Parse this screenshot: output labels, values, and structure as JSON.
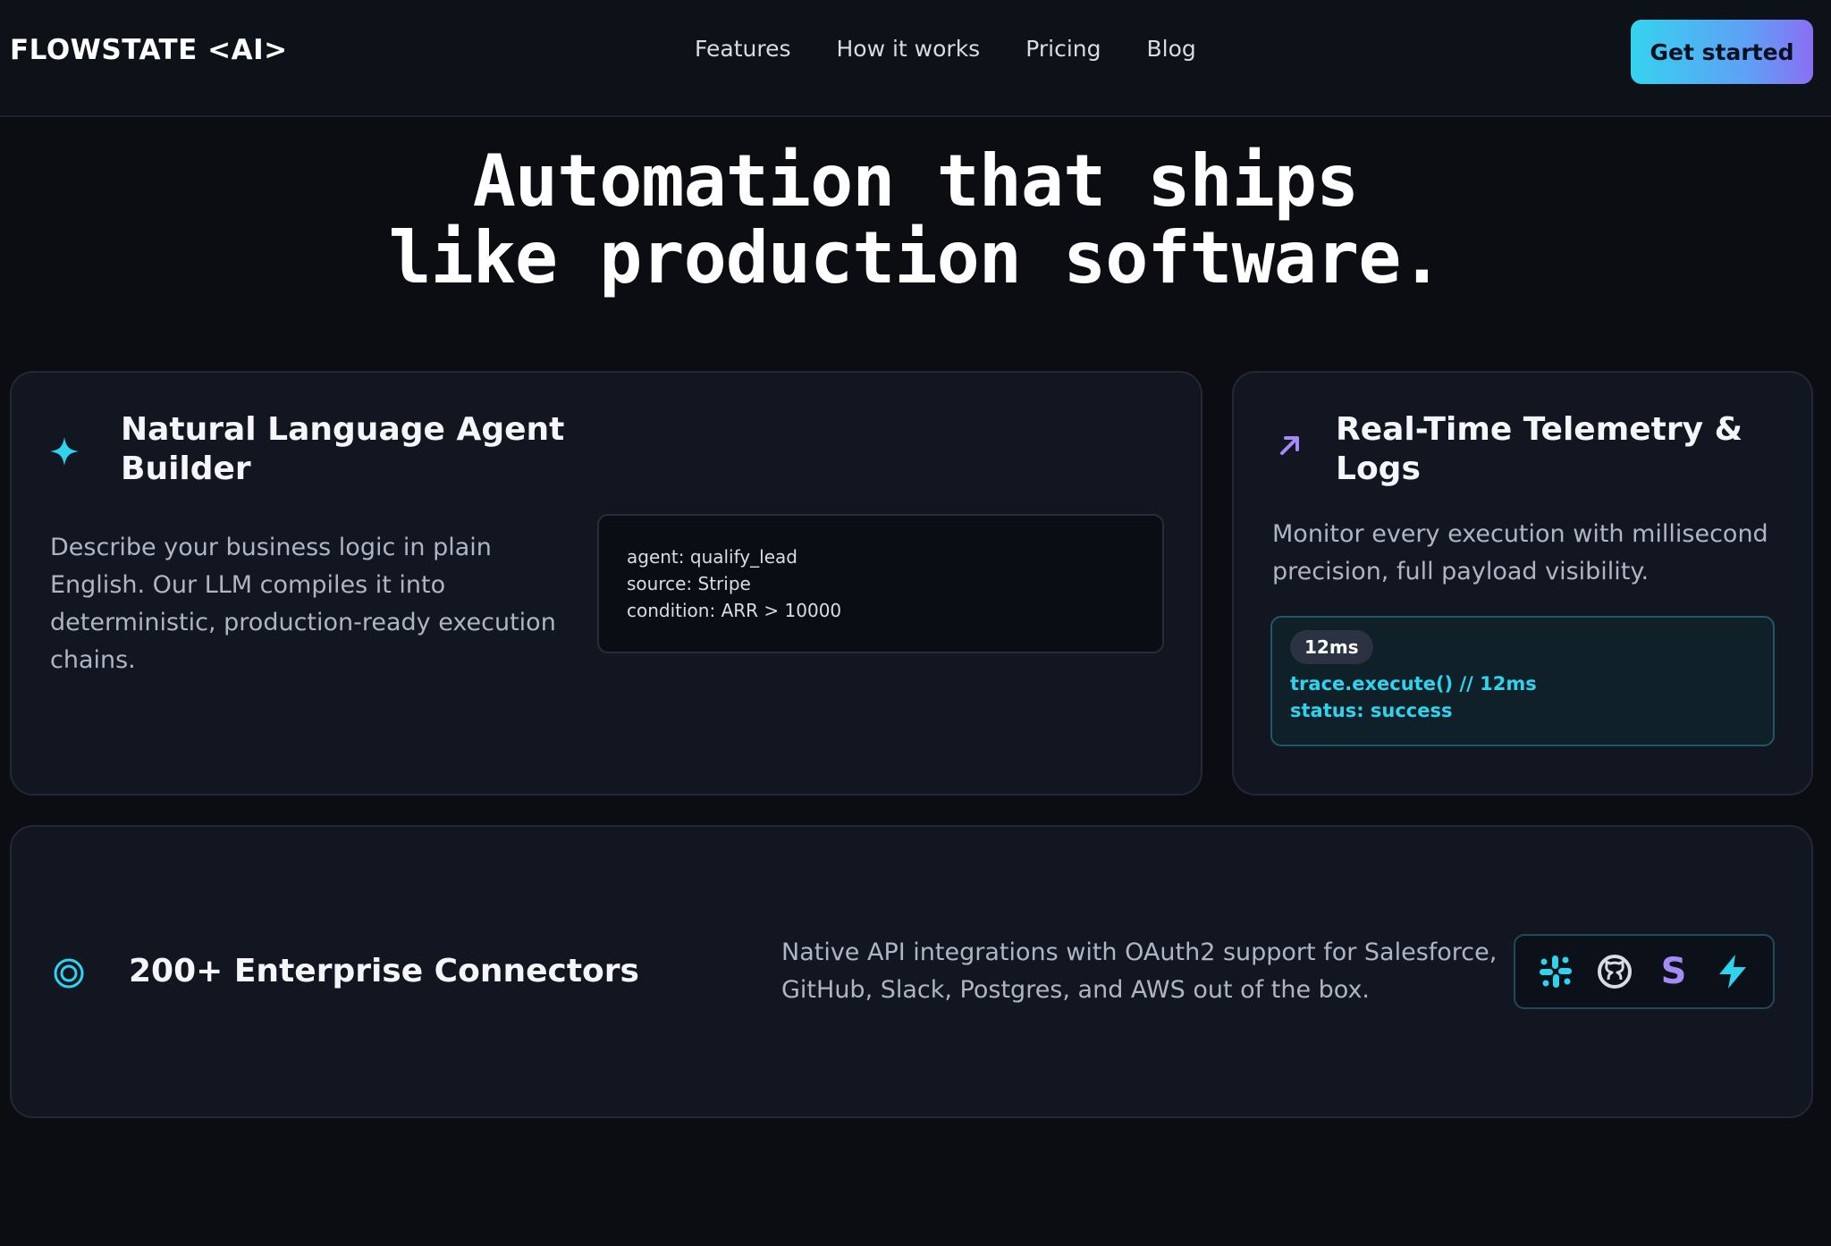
{
  "nav": {
    "brand": "FLOWSTATE <AI>",
    "links": [
      "Features",
      "How it works",
      "Pricing",
      "Blog"
    ],
    "cta": "Get started"
  },
  "hero": {
    "line1": "Automation that ships",
    "line2": "like production software."
  },
  "cards": {
    "agent_builder": {
      "title_line1": "Natural Language Agent",
      "title_line2": "Builder",
      "description_lines": [
        "Describe your business logic in plain",
        "English. Our LLM compiles it into",
        "deterministic, production-ready execution",
        "chains."
      ],
      "code": [
        "agent: qualify_lead",
        "source: Stripe",
        "condition: ARR > 10000"
      ],
      "icon": "sparkle-icon"
    },
    "telemetry": {
      "title_line1": "Real-Time Telemetry &",
      "title_line2": "Logs",
      "description_lines": [
        "Monitor every execution with millisecond",
        "precision, full payload visibility."
      ],
      "badge": "12ms",
      "trace_line": "trace.execute()  // 12ms",
      "status_line": "status: success",
      "icon": "arrow-up-right-icon"
    },
    "connectors": {
      "title": "200+ Enterprise Connectors",
      "description_lines": [
        "Native API integrations with OAuth2 support for Salesforce,",
        "GitHub, Slack, Postgres, and AWS out of the box."
      ],
      "icon": "target-icon",
      "logos": [
        "slack-icon",
        "github-icon",
        "stripe-icon",
        "bolt-icon"
      ]
    }
  },
  "colors": {
    "background": "#0b0d12",
    "card": "#121621",
    "accent_cyan": "#2fd3ee",
    "accent_purple": "#a58bf7"
  }
}
